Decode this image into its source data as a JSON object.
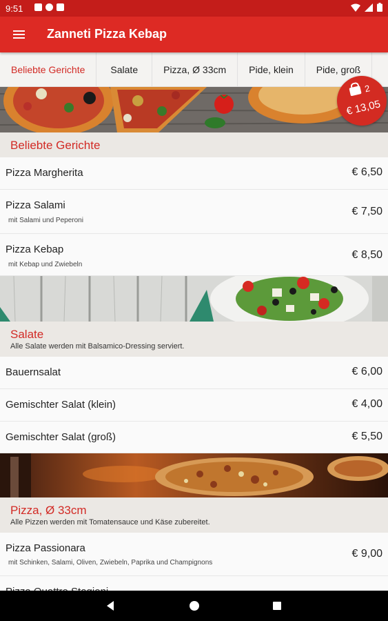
{
  "status_bar": {
    "time": "9:51"
  },
  "app_bar": {
    "title": "Zanneti Pizza Kebap",
    "menu_icon": "hamburger-menu-icon"
  },
  "tabs": [
    {
      "label": "Beliebte Gerichte",
      "active": true
    },
    {
      "label": "Salate",
      "active": false
    },
    {
      "label": "Pizza, Ø 33cm",
      "active": false
    },
    {
      "label": "Pide, klein",
      "active": false
    },
    {
      "label": "Pide, groß",
      "active": false
    }
  ],
  "cart": {
    "count": "2",
    "total": "€ 13,05",
    "icon": "shopping-bag-icon"
  },
  "sections": [
    {
      "title": "Beliebte Gerichte",
      "description": "",
      "items": [
        {
          "name": "Pizza Margherita",
          "description": "",
          "price": "€ 6,50"
        },
        {
          "name": "Pizza Salami",
          "description": "mit Salami und Peperoni",
          "price": "€ 7,50"
        },
        {
          "name": "Pizza Kebap",
          "description": "mit Kebap und Zwiebeln",
          "price": "€ 8,50"
        }
      ]
    },
    {
      "title": "Salate",
      "description": "Alle Salate werden mit Balsamico-Dressing serviert.",
      "items": [
        {
          "name": "Bauernsalat",
          "description": "",
          "price": "€ 6,00"
        },
        {
          "name": "Gemischter Salat (klein)",
          "description": "",
          "price": "€ 4,00"
        },
        {
          "name": "Gemischter Salat (groß)",
          "description": "",
          "price": "€ 5,50"
        }
      ]
    },
    {
      "title": "Pizza, Ø 33cm",
      "description": "Alle Pizzen werden mit Tomatensauce und Käse zubereitet.",
      "items": [
        {
          "name": "Pizza Passionara",
          "description": "mit Schinken, Salami, Oliven, Zwiebeln, Paprika und Champignons",
          "price": "€ 9,00"
        },
        {
          "name": "Pizza Quattro Stagioni",
          "description": "",
          "price": ""
        }
      ]
    }
  ],
  "colors": {
    "primary": "#dd2a24",
    "status_bar": "#c41d1a",
    "accent_text": "#d22a25",
    "section_bg": "#ebe8e4"
  }
}
